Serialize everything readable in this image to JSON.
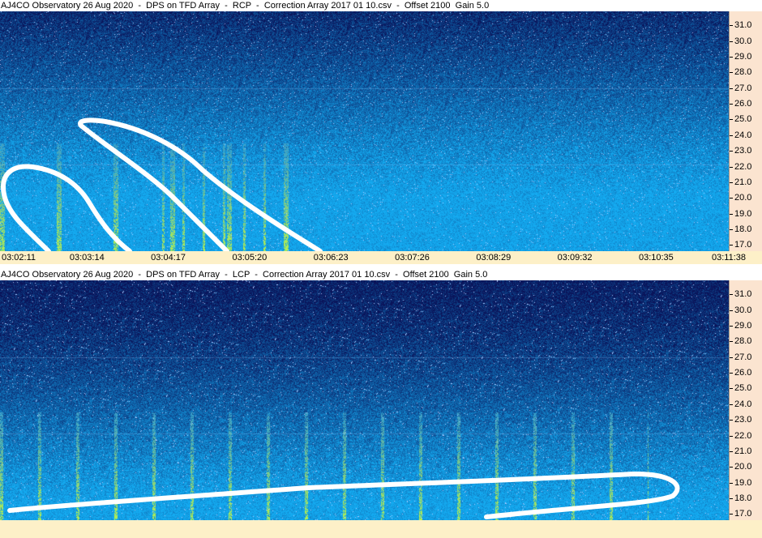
{
  "panels": [
    {
      "title": "AJ4CO Observatory 26 Aug 2020  -  DPS on TFD Array  -  RCP  -  Correction Array 2017 01 10.csv  -  Offset 2100  Gain 5.0",
      "polarization": "RCP"
    },
    {
      "title": "AJ4CO Observatory 26 Aug 2020  -  DPS on TFD Array  -  LCP  -  Correction Array 2017 01 10.csv  -  Offset 2100  Gain 5.0",
      "polarization": "LCP"
    }
  ],
  "time_labels": [
    "03:02:11",
    "03:03:14",
    "03:04:17",
    "03:05:20",
    "03:06:23",
    "03:07:26",
    "03:08:29",
    "03:09:32",
    "03:10:35",
    "03:11:38"
  ],
  "colors": {
    "background_high": "#0a1a5c",
    "background_low": "#1a8fe0",
    "burst": "#9fe35a",
    "axis_panel": "#fbe4d0",
    "time_bar": "#fdf0c8",
    "annotation": "#ffffff"
  },
  "chart_data": [
    {
      "type": "heatmap",
      "title": "AJ4CO Observatory 26 Aug 2020  -  DPS on TFD Array  -  RCP  -  Correction Array 2017 01 10.csv  -  Offset 2100  Gain 5.0",
      "x": [
        "03:02:11",
        "03:03:14",
        "03:04:17",
        "03:05:20",
        "03:06:23",
        "03:07:26",
        "03:08:29",
        "03:09:32",
        "03:10:35",
        "03:11:38"
      ],
      "y_ticks": [
        "31.0",
        "30.0",
        "29.0",
        "28.0",
        "27.0",
        "26.0",
        "25.0",
        "24.0",
        "23.0",
        "22.0",
        "21.0",
        "20.0",
        "19.0",
        "18.0",
        "17.0"
      ],
      "ylabel_unit": "",
      "ylim": [
        16.6,
        31.9
      ],
      "annotations": "hand-drawn white outlines around drifting emission bursts"
    },
    {
      "type": "heatmap",
      "title": "AJ4CO Observatory 26 Aug 2020  -  DPS on TFD Array  -  LCP  -  Correction Array 2017 01 10.csv  -  Offset 2100  Gain 5.0",
      "x": [
        "03:02:11",
        "03:03:14",
        "03:04:17",
        "03:05:20",
        "03:06:23",
        "03:07:26",
        "03:08:29",
        "03:09:32",
        "03:10:35",
        "03:11:38"
      ],
      "y_ticks": [
        "31.0",
        "30.0",
        "29.0",
        "28.0",
        "27.0",
        "26.0",
        "25.0",
        "24.0",
        "23.0",
        "22.0",
        "21.0",
        "20.0",
        "19.0",
        "18.0",
        "17.0"
      ],
      "ylim": [
        16.6,
        31.9
      ],
      "annotations": "hand-drawn white outline around low-frequency emission band"
    }
  ]
}
